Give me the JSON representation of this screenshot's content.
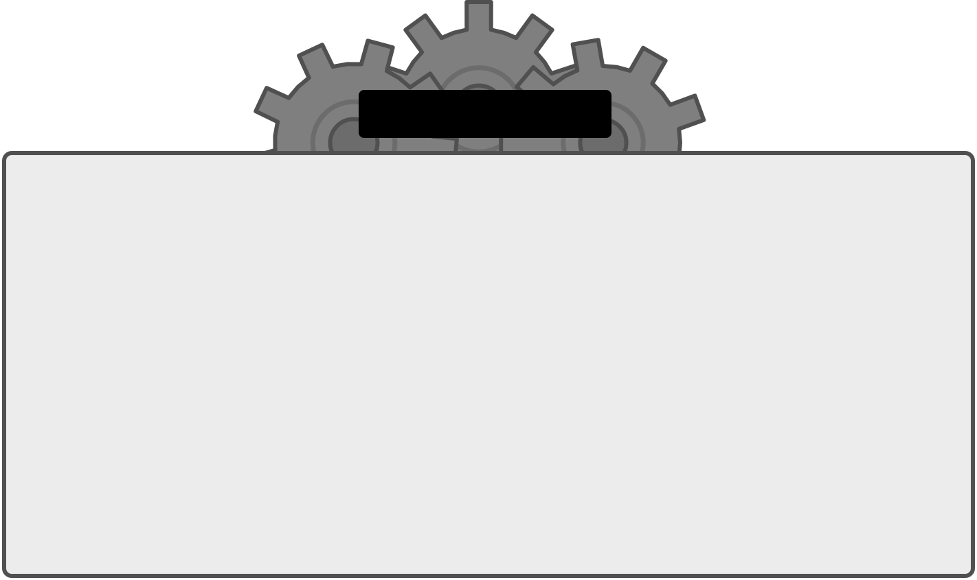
{
  "colors": {
    "background": "#ffffff",
    "gear_fill": "#7f7f7f",
    "gear_inner": "#6c6c6c",
    "gear_outline": "#505050",
    "label_bar": "#000000",
    "panel_fill": "#ececec",
    "panel_border": "#505050"
  },
  "icons": {
    "gears": "gears-icon"
  }
}
